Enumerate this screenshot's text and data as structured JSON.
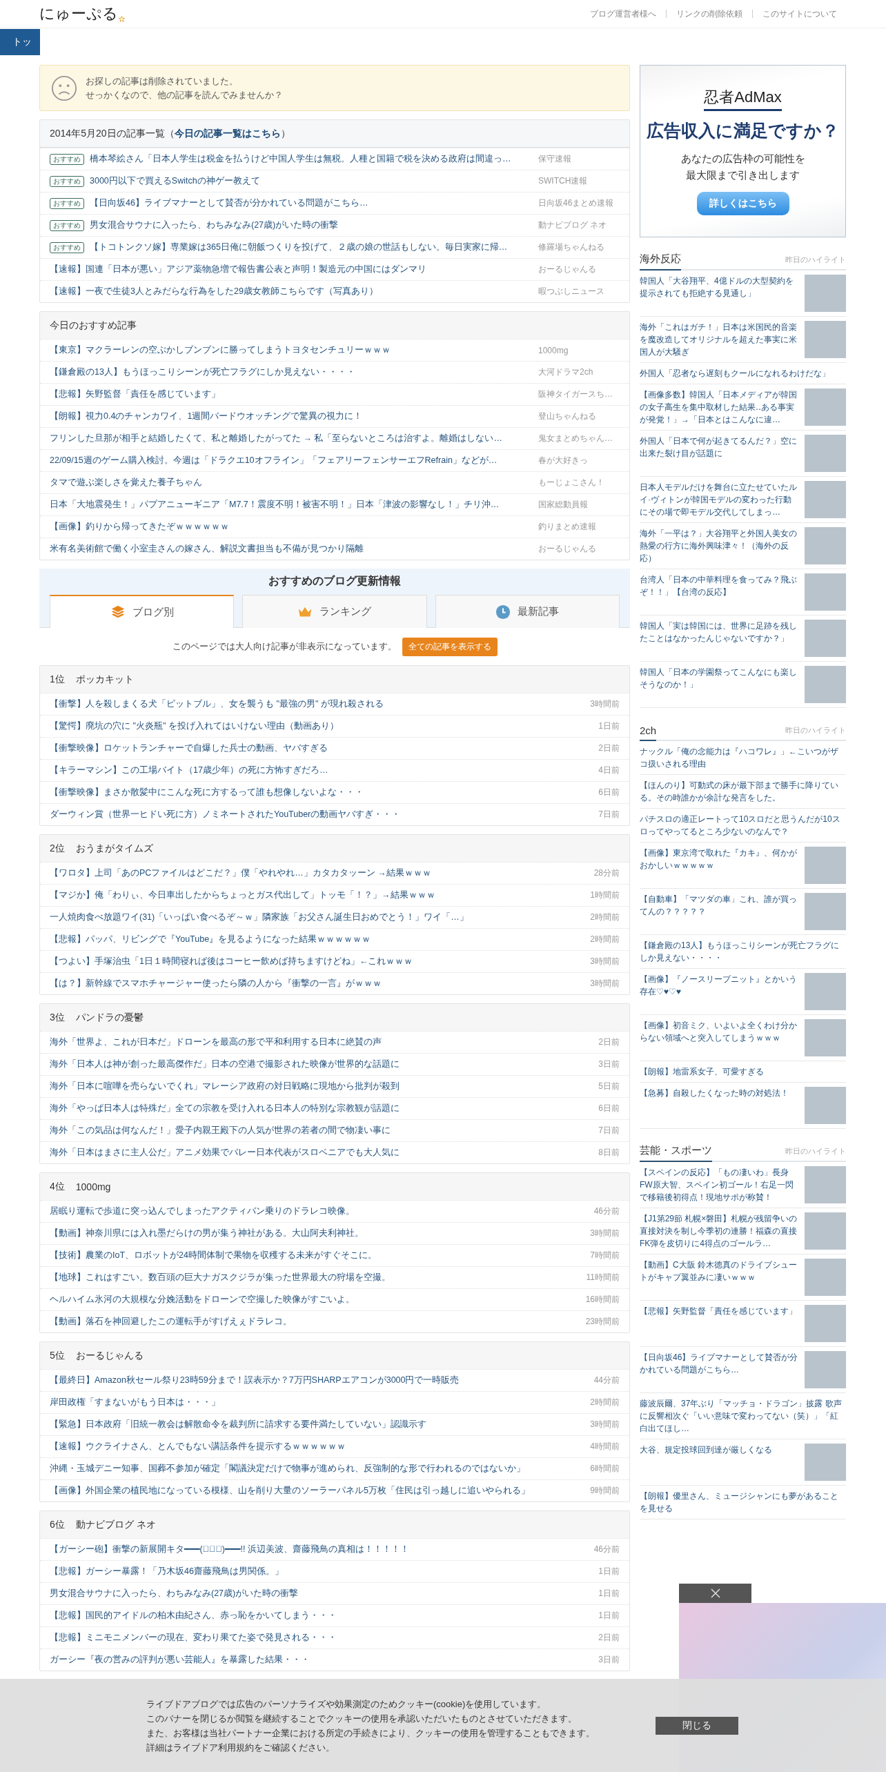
{
  "header": {
    "logo": "にゅーぷる",
    "links": [
      "ブログ運営者様へ",
      "リンクの削除依頼",
      "このサイトについて"
    ]
  },
  "nav": {
    "tabs": [
      {
        "label": "トッ"
      }
    ]
  },
  "notice": {
    "lines": [
      "お探しの記事は削除されていました。",
      "せっかくなので、他の記事を読んでみませんか？"
    ]
  },
  "archive": {
    "title_before": "2014年5月20日の記事一覧（",
    "title_link": "今日の記事一覧はこちら",
    "title_after": "）",
    "rows": [
      {
        "badge": "おすすめ",
        "title": "橋本琴絵さん「日本人学生は税金を払うけど中国人学生は無税。人種と国籍で税を決める政府は間違っ…",
        "source": "保守速報"
      },
      {
        "badge": "おすすめ",
        "title": "3000円以下で買えるSwitchの神ゲー教えて",
        "source": "SWITCH速報"
      },
      {
        "badge": "おすすめ",
        "title": "【日向坂46】ライブマナーとして賛否が分かれている問題がこちら…",
        "source": "日向坂46まとめ速報"
      },
      {
        "badge": "おすすめ",
        "title": "男女混合サウナに入ったら、わちみなみ(27歳)がいた時の衝撃",
        "source": "動ナビブログ ネオ"
      },
      {
        "badge": "おすすめ",
        "title": "【トコトンクソ嫁】専業嫁は365日俺に朝飯つくりを投げて、２歳の娘の世話もしない。毎日実家に帰…",
        "source": "修羅場ちゃんねる"
      },
      {
        "title": "【速報】国連「日本が悪い」アジア薬物急増で報告書公表と声明！製造元の中国にはダンマリ",
        "source": "おーるじゃんる"
      },
      {
        "title": "【速報】一夜で生徒3人とみだらな行為をした29歳女教師こちらです（写真あり）",
        "source": "暇つぶしニュース"
      }
    ]
  },
  "today": {
    "title": "今日のおすすめ記事",
    "rows": [
      {
        "title": "【東京】マクラーレンの空ぶかしブンブンに勝ってしまうトヨタセンチュリーｗｗｗ",
        "source": "1000mg"
      },
      {
        "title": "【鎌倉殿の13人】もうほっこりシーンが死亡フラグにしか見えない・・・・",
        "source": "大河ドラマ2ch"
      },
      {
        "title": "【悲報】矢野監督「責任を感じています」",
        "source": "阪神タイガースち…"
      },
      {
        "title": "【朗報】視力0.4のチャンカワイ、1週間バードウオッチングで驚異の視力に！",
        "source": "登山ちゃんねる"
      },
      {
        "title": "フリンした旦那が相手と結婚したくて、私と離婚したがってた → 私「至らないところは治すよ。離婚はしない…",
        "source": "鬼女まとめちゃん…"
      },
      {
        "title": "22/09/15週のゲーム購入検討。今週は「ドラクエ10オフライン」「フェアリーフェンサーエフRefrain」などが…",
        "source": "春が大好きっ"
      },
      {
        "title": "タマで遊ぶ楽しさを覚えた養子ちゃん",
        "source": "もーじょこさん！"
      },
      {
        "title": "日本「大地震発生！」パプアニューギニア「M7.7！震度不明！被害不明！」日本「津波の影響なし！」チリ沖…",
        "source": "国家総動員報"
      },
      {
        "title": "【画像】釣りから帰ってきたぞｗｗｗｗｗｗ",
        "source": "釣りまとめ速報"
      },
      {
        "title": "米有名美術館で働く小室圭さんの嫁さん、解説文書担当も不備が見つかり隔離",
        "source": "おーるじゃんる"
      }
    ]
  },
  "blog_updates": {
    "title": "おすすめのブログ更新情報",
    "tabs": [
      {
        "label": "ブログ別",
        "selected": true
      },
      {
        "label": "ランキング",
        "selected": false
      },
      {
        "label": "最新記事",
        "selected": false
      }
    ],
    "filter_note": "このページでは大人向け記事が非表示になっています。",
    "filter_button": "全ての記事を表示する",
    "rankings": [
      {
        "rank": "1位",
        "blog": "ポッカキット",
        "rows": [
          {
            "title": "【衝撃】人を殺しまくる犬「ピットブル」、女を襲うも \"最強の男\" が現れ殺される",
            "time": "3時間前"
          },
          {
            "title": "【驚愕】廃坑の穴に \"火炎瓶\" を投げ入れてはいけない理由（動画あり）",
            "time": "1日前"
          },
          {
            "title": "【衝撃映像】ロケットランチャーで自爆した兵士の動画、ヤバすぎる",
            "time": "2日前"
          },
          {
            "title": "【キラーマシン】この工場バイト（17歳少年）の死に方怖すぎだろ…",
            "time": "4日前"
          },
          {
            "title": "【衝撃映像】まさか散髪中にこんな死に方するって誰も想像しないよな・・・",
            "time": "6日前"
          },
          {
            "title": "ダーウィン賞（世界一ヒドい死に方）ノミネートされたYouTuberの動画ヤバすぎ・・・",
            "time": "7日前"
          }
        ]
      },
      {
        "rank": "2位",
        "blog": "おうまがタイムズ",
        "rows": [
          {
            "title": "【ワロタ】上司「あのPCファイルはどこだ？」僕「やれやれ…」カタカタッーン →結果ｗｗｗ",
            "time": "28分前"
          },
          {
            "title": "【マジか】俺「わりぃ、今日車出したからちょっとガス代出して」トッモ「！？」→結果ｗｗｗ",
            "time": "1時間前"
          },
          {
            "title": "一人焼肉食べ放題ワイ(31)「いっぱい食べるぞ～ｗ」隣家族「お父さん誕生日おめでとう！」ワイ「…」",
            "time": "2時間前"
          },
          {
            "title": "【悲報】パッパ、リビングで『YouTube』を見るようになった結果ｗｗｗｗｗｗ",
            "time": "2時間前"
          },
          {
            "title": "【つよい】手塚治虫「1日１時間寝れば後はコーヒー飲めば持ちますけどね」←これｗｗｗ",
            "time": "3時間前"
          },
          {
            "title": "【は？】新幹線でスマホチャージャー使ったら隣の人から『衝撃の一言』がｗｗｗ",
            "time": "3時間前"
          }
        ]
      },
      {
        "rank": "3位",
        "blog": "パンドラの憂鬱",
        "rows": [
          {
            "title": "海外「世界よ、これが日本だ」ドローンを最高の形で平和利用する日本に絶賛の声",
            "time": "2日前"
          },
          {
            "title": "海外「日本人は神が創った最高傑作だ」日本の空港で撮影された映像が世界的な話題に",
            "time": "3日前"
          },
          {
            "title": "海外「日本に喧嘩を売らないでくれ」マレーシア政府の対日戦略に現地から批判が殺到",
            "time": "5日前"
          },
          {
            "title": "海外「やっぱ日本人は特殊だ」全ての宗教を受け入れる日本人の特別な宗教観が話題に",
            "time": "6日前"
          },
          {
            "title": "海外「この気品は何なんだ！」愛子内親王殿下の人気が世界の若者の間で物凄い事に",
            "time": "7日前"
          },
          {
            "title": "海外「日本はまさに主人公だ」アニメ効果でバレー日本代表がスロベニアでも大人気に",
            "time": "8日前"
          }
        ]
      },
      {
        "rank": "4位",
        "blog": "1000mg",
        "rows": [
          {
            "title": "居眠り運転で歩道に突っ込んでしまったアクティバン乗りのドラレコ映像。",
            "time": "46分前"
          },
          {
            "title": "【動画】神奈川県には入れ墨だらけの男が集う神社がある。大山阿夫利神社。",
            "time": "3時間前"
          },
          {
            "title": "【技術】農業のIoT、ロボットが24時間体制で果物を収穫する未来がすぐそこに。",
            "time": "7時間前"
          },
          {
            "title": "【地球】これはすごい。数百頭の巨大ナガスクジラが集った世界最大の狩場を空撮。",
            "time": "11時間前"
          },
          {
            "title": "ヘルハイム氷河の大規模な分娩活動をドローンで空撮した映像がすごいよ。",
            "time": "16時間前"
          },
          {
            "title": "【動画】落石を神回避したこの運転手がすげえぇドラレコ。",
            "time": "23時間前"
          }
        ]
      },
      {
        "rank": "5位",
        "blog": "おーるじゃんる",
        "rows": [
          {
            "title": "【最終日】Amazon秋セール祭り23時59分まで！誤表示か？7万円SHARPエアコンが3000円で一時販売",
            "time": "44分前"
          },
          {
            "title": "岸田政権「すまないがもう日本は・・・」",
            "time": "2時間前"
          },
          {
            "title": "【緊急】日本政府「旧統一教会は解散命令を裁判所に請求する要件満たしていない」認識示す",
            "time": "3時間前"
          },
          {
            "title": "【速報】ウクライナさん、とんでもない講話条件を提示するｗｗｗｗｗｗ",
            "time": "4時間前"
          },
          {
            "title": "沖縄・玉城デニー知事、国葬不参加が確定「閣議決定だけで物事が進められ、反強制的な形で行われるのではないか」",
            "time": "6時間前"
          },
          {
            "title": "【画像】外国企業の植民地になっている模様、山を削り大量のソーラーパネル5万枚「住民は引っ越しに追いやられる」",
            "time": "9時間前"
          }
        ]
      },
      {
        "rank": "6位",
        "blog": "動ナビブログ ネオ",
        "rows": [
          {
            "title": "【ガーシー砲】衝撃の新展開キタ━━━(ﾟ∀ﾟ)━━━!! 浜辺美波、齋藤飛鳥の真相は！！！！！",
            "time": "46分前"
          },
          {
            "title": "【悲報】ガーシー暴露！「乃木坂46齋藤飛鳥は男関係。」",
            "time": "1日前"
          },
          {
            "title": "男女混合サウナに入ったら、わちみなみ(27歳)がいた時の衝撃",
            "time": "1日前"
          },
          {
            "title": "【悲報】国民的アイドルの柏木由紀さん、赤っ恥をかいてしまう・・・",
            "time": "1日前"
          },
          {
            "title": "【悲報】ミニモニメンバーの現在、変わり果てた姿で発見される・・・",
            "time": "2日前"
          },
          {
            "title": "ガーシー『夜の営みの評判が悪い芸能人』を暴露した結果・・・",
            "time": "3日前"
          }
        ]
      }
    ]
  },
  "sidebar": {
    "ad": {
      "brand": "忍者AdMax",
      "headline": "広告収入に満足ですか？",
      "lines": [
        "あなたの広告枠の可能性を",
        "最大限まで引き出します"
      ],
      "button": "詳しくはこちら"
    },
    "sections": [
      {
        "title": "海外反応",
        "subtitle": "昨日のハイライト",
        "items": [
          {
            "title": "韓国人「大谷翔平、4億ドルの大型契約を提示されても拒絶する見通し」",
            "has_image": true
          },
          {
            "title": "海外「これはガチ！」日本は米国民的音楽を魔改造してオリジナルを超えた事実に米国人が大騒ぎ",
            "has_image": true
          },
          {
            "title": "外国人「忍者なら遅刻もクールになれるわけだな」",
            "has_image": false
          },
          {
            "title": "【画像多数】韓国人「日本メディアが韓国の女子高生を集中取材した結果‥ある事実が発覚！」→「日本とはこんなに違…",
            "has_image": true
          },
          {
            "title": "外国人「日本で何が起きてるんだ？」空に出来た裂け目が話題に",
            "has_image": true
          },
          {
            "title": "日本人モデルだけを舞台に立たせていたルイ·ヴィトンが韓国モデルの変わった行動にその場で即モデル交代してしまっ…",
            "has_image": true
          },
          {
            "title": "海外「一平は？」大谷翔平と外国人美女の熱愛の行方に海外興味津々！（海外の反応）",
            "has_image": true
          },
          {
            "title": "台湾人「日本の中華料理を食ってみ？飛ぶぞ！！」【台湾の反応】",
            "has_image": true
          },
          {
            "title": "韓国人「実は韓国には、世界に足跡を残したことはなかったんじゃないですか？」",
            "has_image": true
          },
          {
            "title": "韓国人「日本の学園祭ってこんなにも楽しそうなのか！」",
            "has_image": true
          }
        ]
      },
      {
        "title": "2ch",
        "subtitle": "昨日のハイライト",
        "items": [
          {
            "title": "ナックル「俺の念能力は『ハコワレ』」←こいつがザコ扱いされる理由",
            "has_image": false
          },
          {
            "title": "【ほんのり】可動式の床が最下部まで勝手に降りている。その時誰かが余計な発言をした。",
            "has_image": false
          },
          {
            "title": "パチスロの適正レートって10スロだと思うんだが10スロってやってるところ少ないのなんで？",
            "has_image": false
          },
          {
            "title": "【画像】東京湾で取れた『カキ』、何かがおかしいｗｗｗｗｗ",
            "has_image": true
          },
          {
            "title": "【自動車】「マツダの車」これ、誰が買ってんの？？？？？",
            "has_image": true
          },
          {
            "title": "【鎌倉殿の13人】もうほっこりシーンが死亡フラグにしか見えない・・・・",
            "has_image": false
          },
          {
            "title": "【画像】『ノースリーブニット』とかいう存在♡♥♡♥",
            "has_image": true
          },
          {
            "title": "【画像】初音ミク、いよいよ全くわけ分からない領域へと突入してしまうｗｗｗ",
            "has_image": true
          },
          {
            "title": "【朗報】地雷系女子、可愛すぎる",
            "has_image": false
          },
          {
            "title": "【急募】自殺したくなった時の対処法！",
            "has_image": true
          }
        ]
      },
      {
        "title": "芸能・スポーツ",
        "subtitle": "昨日のハイライト",
        "items": [
          {
            "title": "【スペインの反応】「もの凄いわ」長身FW原大智、スペイン初ゴール！右足一閃で移籍後初得点！現地サポが称賛！",
            "has_image": true
          },
          {
            "title": "【J1第29節 札幌×磐田】札幌が残留争いの直接対決を制し今季初の連勝！福森の直接FK弾を皮切りに4得点のゴールラ…",
            "has_image": true
          },
          {
            "title": "【動画】C大阪 鈴木徳真のドライブシュートがキャプ翼並みに凄いｗｗｗ",
            "has_image": true
          },
          {
            "title": "【悲報】矢野監督「責任を感じています」",
            "has_image": true
          },
          {
            "title": "【日向坂46】ライブマナーとして賛否が分かれている問題がこちら…",
            "has_image": true
          },
          {
            "title": "藤波辰爾、37年ぶり「マッチョ・ドラゴン」披露 歌声に反響相次ぐ「いい意味で変わってない（笑）」「紅白出てほし…",
            "has_image": false
          },
          {
            "title": "大谷、規定投球回到達が厳しくなる",
            "has_image": true
          },
          {
            "title": "【朗報】優里さん、ミュージシャンにも夢があることを見せる",
            "has_image": false
          }
        ]
      }
    ]
  },
  "cookie_banner": {
    "lines": [
      "ライブドアブログでは広告のパーソナライズや効果測定のためクッキー(cookie)を使用しています。",
      "このバナーを閉じるか閲覧を継続することでクッキーの使用を承認いただいたものとさせていただきます。",
      "また、お客様は当社パートナー企業における所定の手続きにより、クッキーの使用を管理することもできます。"
    ],
    "detail_before": "詳細は",
    "detail_link": "ライブドア利用規約",
    "detail_after": "をご確認ください。",
    "button": "閉じる"
  }
}
